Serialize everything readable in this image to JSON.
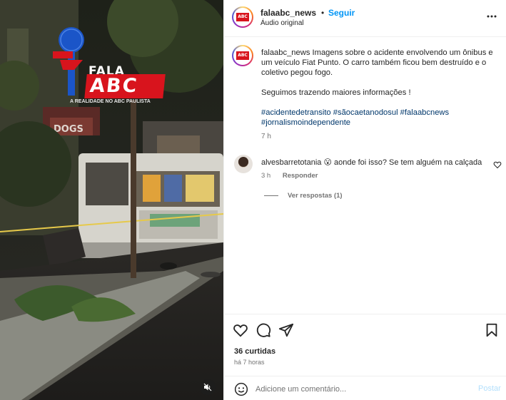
{
  "header": {
    "username": "falaabc_news",
    "separator": "•",
    "follow_label": "Seguir",
    "audio_label": "Áudio original"
  },
  "media": {
    "logo": {
      "top_word": "FALA",
      "main_word": "ABC",
      "tagline": "A REALIDADE NO ABC PAULISTA"
    }
  },
  "caption": {
    "username": "falaabc_news",
    "text": "Imagens sobre o acidente envolvendo um ônibus e um veículo Fiat Punto. O carro também ficou bem destruído e o coletivo pegou fogo.",
    "followup": "Seguimos trazendo maiores informações !",
    "hashtags_line1": "#acidentedetransito #sãocaetanodosul #falaabcnews",
    "hashtags_line2": "#jornalismoindependente",
    "time": "7 h"
  },
  "comments": [
    {
      "username": "alvesbarretotania",
      "emoji": "😮",
      "text": "aonde foi isso? Se tem alguém na calçada",
      "time": "3 h",
      "reply_label": "Responder",
      "view_replies_label": "Ver respostas (1)"
    }
  ],
  "actions": {
    "likes": "36 curtidas",
    "posted_ago": "há 7 horas"
  },
  "composer": {
    "placeholder": "Adicione um comentário...",
    "post_label": "Postar"
  },
  "colors": {
    "link_blue": "#0095f6",
    "hashtag_blue": "#00376b",
    "muted_gray": "#737373",
    "brand_red": "#d8141d",
    "brand_blue": "#1b55c8"
  }
}
